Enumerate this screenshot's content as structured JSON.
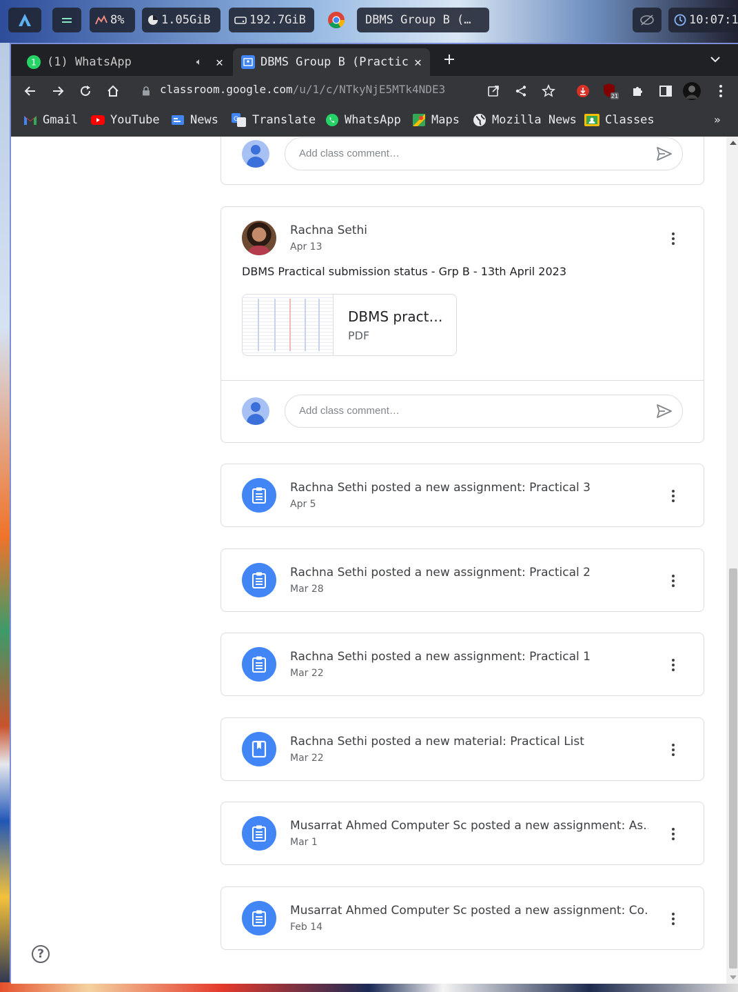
{
  "taskbar": {
    "cpu": "8%",
    "memory": "1.05GiB",
    "disk": "192.7GiB",
    "active_window": "DBMS Group B (…",
    "clock": "10:07:1"
  },
  "tabs": [
    {
      "label": "(1) WhatsApp",
      "badge": "1"
    },
    {
      "label": "DBMS Group B (Practical"
    }
  ],
  "address_bar": {
    "host": "classroom.google.com",
    "path": "/u/1/c/NTkyNjE5MTk4NDE3"
  },
  "extensions": {
    "ublock_count": "21"
  },
  "bookmarks": [
    {
      "label": "Gmail"
    },
    {
      "label": "YouTube"
    },
    {
      "label": "News"
    },
    {
      "label": "Translate"
    },
    {
      "label": "WhatsApp"
    },
    {
      "label": "Maps"
    },
    {
      "label": "Mozilla News"
    },
    {
      "label": "Classes"
    }
  ],
  "stream": {
    "comment_placeholder": "Add class comment…",
    "announcement": {
      "author": "Rachna Sethi",
      "date": "Apr 13",
      "text": "DBMS Practical submission status - Grp B - 13th April 2023",
      "attachment_title": "DBMS pract…",
      "attachment_type": "PDF"
    },
    "items": [
      {
        "title": "Rachna Sethi posted a new assignment: Practical 3",
        "date": "Apr 5",
        "icon": "assignment-icon"
      },
      {
        "title": "Rachna Sethi posted a new assignment: Practical 2",
        "date": "Mar 28",
        "icon": "assignment-icon"
      },
      {
        "title": "Rachna Sethi posted a new assignment: Practical 1",
        "date": "Mar 22",
        "icon": "assignment-icon"
      },
      {
        "title": "Rachna Sethi posted a new material: Practical List",
        "date": "Mar 22",
        "icon": "material-icon"
      },
      {
        "title": "Musarrat Ahmed Computer Sc posted a new assignment: As…",
        "date": "Mar 1",
        "icon": "assignment-icon"
      },
      {
        "title": "Musarrat Ahmed Computer Sc posted a new assignment: Co…",
        "date": "Feb 14",
        "icon": "assignment-icon"
      }
    ]
  },
  "help_label": "?",
  "colors": {
    "accent": "#4285f4",
    "chrome_dark": "#202124",
    "chrome_toolbar": "#35363a",
    "border": "#dadce0"
  }
}
